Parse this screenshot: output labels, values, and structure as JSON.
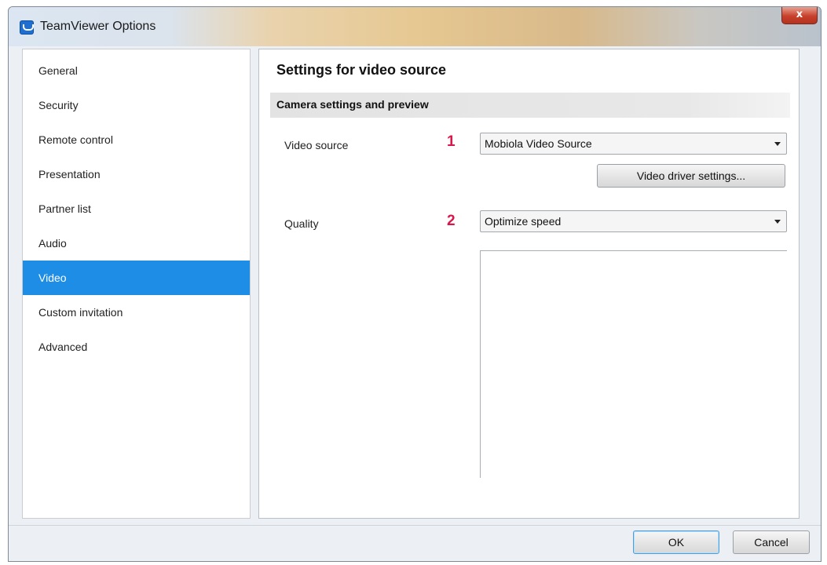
{
  "window": {
    "title": "TeamViewer Options",
    "close_glyph": "x"
  },
  "sidebar": {
    "items": [
      {
        "label": "General",
        "selected": false
      },
      {
        "label": "Security",
        "selected": false
      },
      {
        "label": "Remote control",
        "selected": false
      },
      {
        "label": "Presentation",
        "selected": false
      },
      {
        "label": "Partner list",
        "selected": false
      },
      {
        "label": "Audio",
        "selected": false
      },
      {
        "label": "Video",
        "selected": true
      },
      {
        "label": "Custom invitation",
        "selected": false
      },
      {
        "label": "Advanced",
        "selected": false
      }
    ]
  },
  "panel": {
    "title": "Settings for video source",
    "section_title": "Camera settings and preview",
    "video_source": {
      "label": "Video source",
      "marker": "1",
      "value": "Mobiola Video Source"
    },
    "driver_button": "Video driver settings...",
    "quality": {
      "label": "Quality",
      "marker": "2",
      "value": "Optimize speed"
    }
  },
  "footer": {
    "ok": "OK",
    "cancel": "Cancel"
  },
  "colors": {
    "selected_nav": "#1e8de6",
    "marker": "#d8184a"
  }
}
